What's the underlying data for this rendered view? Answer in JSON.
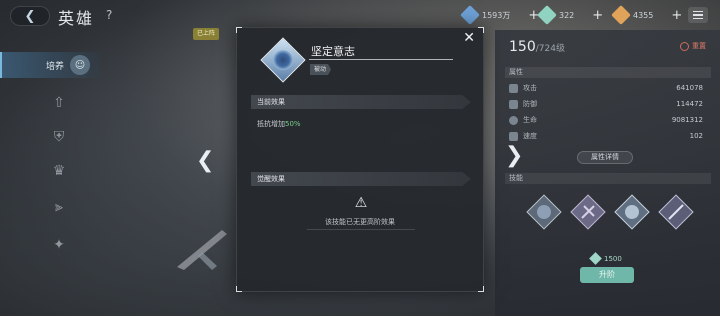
{
  "header": {
    "title": "英雄",
    "resources": [
      {
        "value": "1593万",
        "color": "#6ea2d8"
      },
      {
        "value": "322",
        "color": "#8fd3c0"
      },
      {
        "value": "4355",
        "color": "#e0a35a"
      }
    ]
  },
  "left_nav": {
    "active_label": "培养"
  },
  "hero": {
    "top_tag": "已上阵"
  },
  "right_panel": {
    "level": "150",
    "level_max": "/724级",
    "reset_label": "重置",
    "attr_section": "属性",
    "attributes": [
      {
        "name": "攻击",
        "value": "641078"
      },
      {
        "name": "防御",
        "value": "114472"
      },
      {
        "name": "生命",
        "value": "9081312"
      },
      {
        "name": "速度",
        "value": "102"
      }
    ],
    "detail_button": "属性详情",
    "skill_section": "技能",
    "upgrade_cost": "1500",
    "upgrade_button": "升阶"
  },
  "modal": {
    "skill_name": "坚定意志",
    "skill_type": "被动",
    "current_effect_title": "当前效果",
    "current_effect_text": "抵抗增加",
    "current_effect_value": "50%",
    "awaken_title": "觉醒效果",
    "no_more_text": "该技能已无更高阶效果"
  },
  "colors": {
    "accent_green": "#76d18c",
    "upgrade_teal": "#6fb7a9",
    "reset_red": "#e07a6a"
  }
}
